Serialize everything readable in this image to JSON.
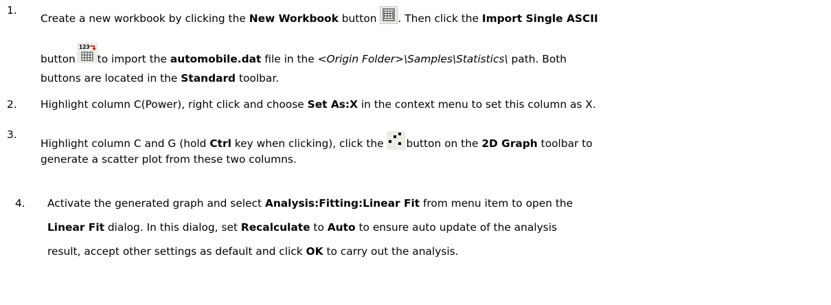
{
  "steps": [
    {
      "num": "1.",
      "a": "Create a new workbook by clicking the ",
      "b": "New Workbook",
      "c": " button ",
      "d": ". Then click the ",
      "e": "Import Single ASCII",
      "f": "button ",
      "g": "to import the ",
      "h": "automobile.dat",
      "i": " file in the ",
      "j": "<Origin Folder>\\Samples\\Statistics\\",
      "k": " path. Both",
      "l": "buttons are located in the ",
      "m": "Standard",
      "n": " toolbar.",
      "icon1": "new-workbook-icon",
      "icon2": "import-single-ascii-icon",
      "icon2_label": "123"
    },
    {
      "num": "2.",
      "a": "Highlight column C(Power), right click and choose ",
      "b": "Set As:X",
      "c": " in the context menu to set this column as X."
    },
    {
      "num": "3.",
      "a": "Highlight column C and G (hold ",
      "b": "Ctrl",
      "c": " key when clicking), click the ",
      "d": "button on the ",
      "e": "2D Graph",
      "f": " toolbar to",
      "g": "generate a scatter plot from these two columns.",
      "icon": "scatter-plot-icon"
    },
    {
      "num": "4.",
      "a": "Activate the generated graph and select ",
      "b": "Analysis:Fitting:Linear Fit",
      "c": " from menu item to open the",
      "d": "Linear Fit",
      "e": " dialog. In this dialog, set ",
      "f": "Recalculate",
      "g": " to ",
      "h": "Auto",
      "i": " to ensure auto update of the analysis",
      "j": "result, accept other settings as default and click ",
      "k": "OK",
      "l": " to carry out the analysis."
    }
  ]
}
